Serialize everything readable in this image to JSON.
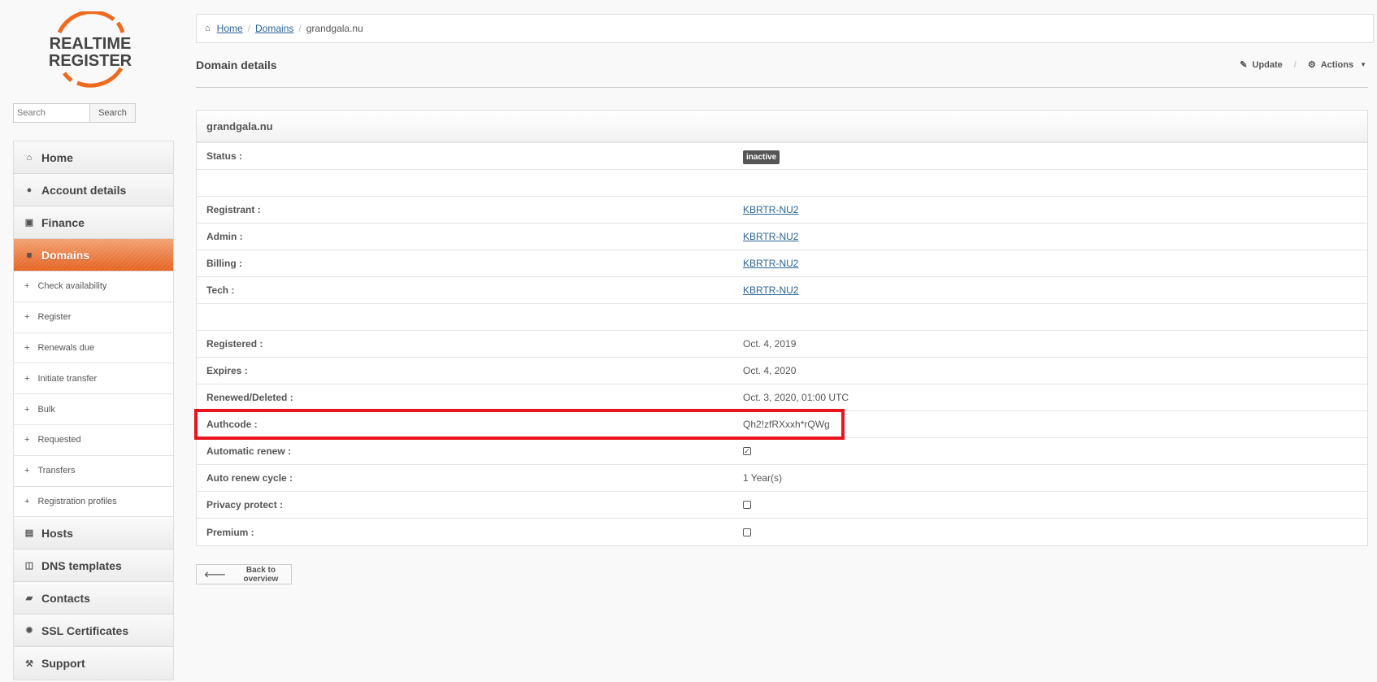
{
  "logo": {
    "line1": "REALTIME",
    "line2": "REGISTER"
  },
  "search": {
    "placeholder": "Search",
    "button": "Search"
  },
  "sidebar": {
    "items": [
      {
        "label": "Home",
        "icon": "home-icon"
      },
      {
        "label": "Account details",
        "icon": "user-icon"
      },
      {
        "label": "Finance",
        "icon": "money-icon"
      },
      {
        "label": "Domains",
        "icon": "list-icon"
      }
    ],
    "subitems": [
      "Check availability",
      "Register",
      "Renewals due",
      "Initiate transfer",
      "Bulk",
      "Requested",
      "Transfers",
      "Registration profiles"
    ],
    "items_after": [
      {
        "label": "Hosts",
        "icon": "hdd-icon"
      },
      {
        "label": "DNS templates",
        "icon": "columns-icon"
      },
      {
        "label": "Contacts",
        "icon": "book-icon"
      },
      {
        "label": "SSL Certificates",
        "icon": "certificate-icon"
      },
      {
        "label": "Support",
        "icon": "wrench-icon"
      }
    ]
  },
  "breadcrumb": {
    "home": "Home",
    "domains": "Domains",
    "current": "grandgala.nu",
    "sep": "/"
  },
  "page": {
    "title": "Domain details",
    "update": "Update",
    "actions": "Actions"
  },
  "panel": {
    "title": "grandgala.nu",
    "status_label": "Status :",
    "status": "inactive",
    "registrant_label": "Registrant :",
    "registrant": "KBRTR-NU2",
    "admin_label": "Admin :",
    "admin": "KBRTR-NU2",
    "billing_label": "Billing :",
    "billing": "KBRTR-NU2",
    "tech_label": "Tech :",
    "tech": "KBRTR-NU2",
    "registered_label": "Registered :",
    "registered": "Oct. 4, 2019",
    "expires_label": "Expires :",
    "expires": "Oct. 4, 2020",
    "renewed_label": "Renewed/Deleted :",
    "renewed": "Oct. 3, 2020, 01:00 UTC",
    "authcode_label": "Authcode :",
    "authcode": "Qh2!zfRXxxh*rQWg",
    "autorenew_label": "Automatic renew :",
    "autorenew": true,
    "cycle_label": "Auto renew cycle :",
    "cycle": "1 Year(s)",
    "privacy_label": "Privacy protect :",
    "privacy": false,
    "premium_label": "Premium :",
    "premium": false
  },
  "back_button": "Back to overview",
  "colors": {
    "accent": "#e5611f",
    "highlight": "#e8141e",
    "link": "#2a6496"
  }
}
